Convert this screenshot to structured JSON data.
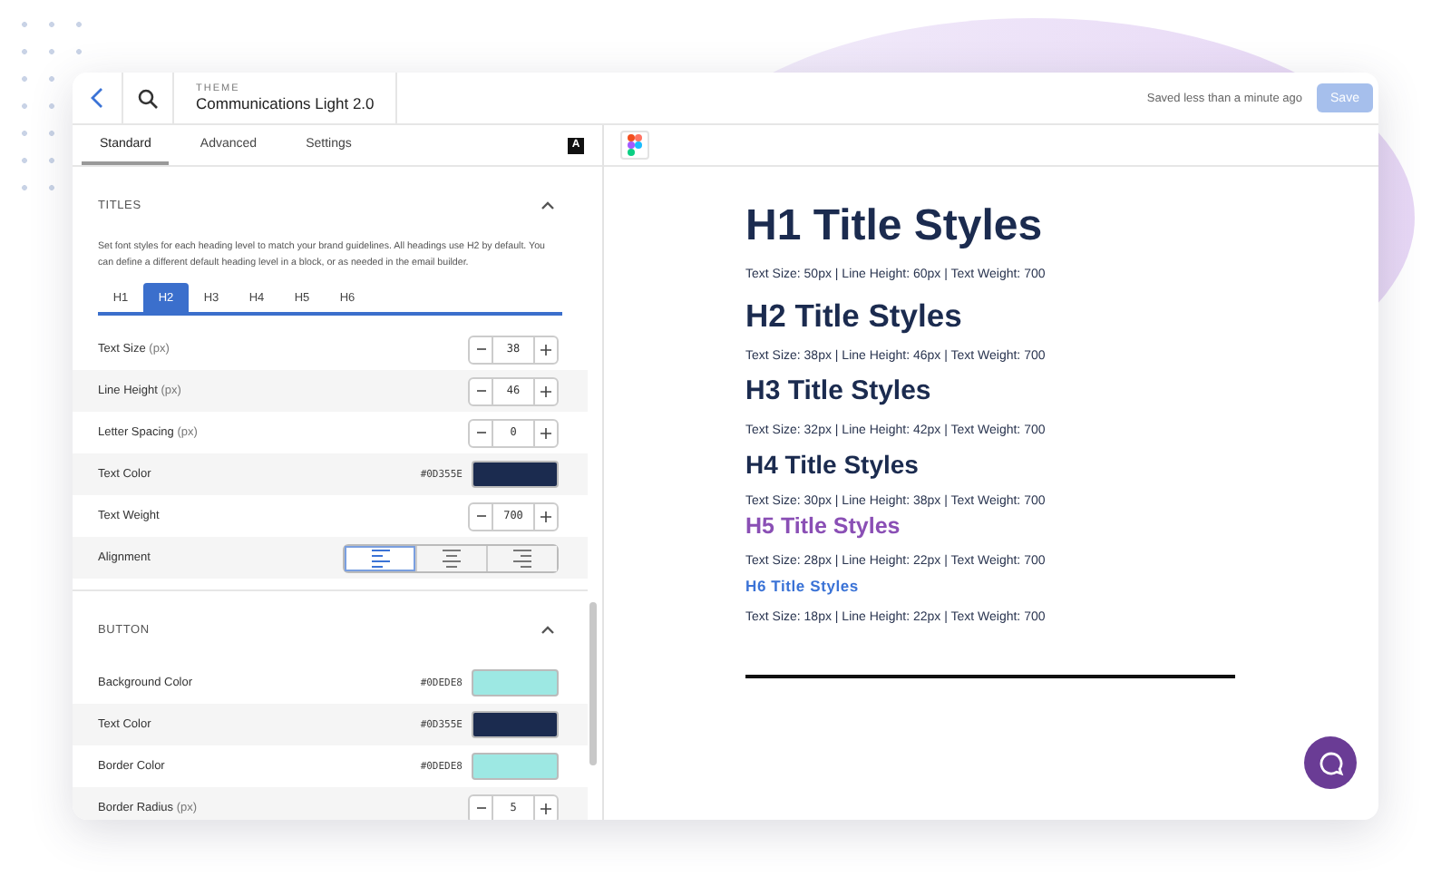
{
  "header": {
    "theme_label": "THEME",
    "theme_name": "Communications Light 2.0",
    "save_status": "Saved less than a minute ago",
    "save_button": "Save"
  },
  "panel_tabs": [
    {
      "label": "Standard",
      "selected": true
    },
    {
      "label": "Advanced",
      "selected": false
    },
    {
      "label": "Settings",
      "selected": false
    }
  ],
  "panel_badge": "A",
  "sections": [
    {
      "title": "TITLES",
      "expanded": true,
      "description": "Set font styles for each heading level to match your brand guidelines. All headings use H2 by default. You can define a different default heading level in a block, or as needed in the email builder.",
      "levels": [
        {
          "label": "H1",
          "selected": false
        },
        {
          "label": "H2",
          "selected": true
        },
        {
          "label": "H3",
          "selected": false
        },
        {
          "label": "H4",
          "selected": false
        },
        {
          "label": "H5",
          "selected": false
        },
        {
          "label": "H6",
          "selected": false
        }
      ],
      "rows": [
        {
          "kind": "stepper",
          "label": "Text Size",
          "unit": "(px)",
          "value": "38"
        },
        {
          "kind": "stepper",
          "label": "Line Height",
          "unit": "(px)",
          "value": "46"
        },
        {
          "kind": "stepper",
          "label": "Letter Spacing",
          "unit": "(px)",
          "value": "0"
        },
        {
          "kind": "color",
          "label": "Text Color",
          "value": "#0D355E",
          "color": "#1b2b4f"
        },
        {
          "kind": "stepper",
          "label": "Text Weight",
          "value": "700"
        },
        {
          "kind": "alignment",
          "label": "Alignment",
          "options": [
            {
              "kind": "left",
              "selected": true
            },
            {
              "kind": "center",
              "selected": false
            },
            {
              "kind": "right",
              "selected": false
            }
          ]
        }
      ]
    },
    {
      "title": "BUTTON",
      "expanded": true,
      "rows": [
        {
          "kind": "color",
          "label": "Background Color",
          "value": "#0DEDE8",
          "color": "#9de8e3"
        },
        {
          "kind": "color",
          "label": "Text Color",
          "value": "#0D355E",
          "color": "#1b2b4f"
        },
        {
          "kind": "color",
          "label": "Border Color",
          "value": "#0DEDE8",
          "color": "#9de8e3"
        },
        {
          "kind": "stepper",
          "label": "Border Radius",
          "unit": "(px)",
          "value": "5"
        }
      ]
    }
  ],
  "preview": [
    {
      "title": "H1 Title Styles",
      "color": "#1b2b4f",
      "specs": "Text Size: 50px | Line Height: 60px | Text Weight: 700"
    },
    {
      "title": "H2 Title Styles",
      "color": "#1b2b4f",
      "specs": "Text Size: 38px | Line Height: 46px | Text Weight: 700"
    },
    {
      "title": "H3 Title Styles",
      "color": "#1b2b4f",
      "specs": "Text Size: 32px | Line Height: 42px | Text Weight: 700"
    },
    {
      "title": "H4 Title Styles",
      "color": "#1b2b4f",
      "specs": "Text Size: 30px | Line Height: 38px | Text Weight: 700"
    },
    {
      "title": "H5 Title Styles",
      "color": "#8a4fb5",
      "specs": "Text Size: 28px | Line Height: 22px | Text Weight: 700"
    },
    {
      "title": "H6 Title Styles",
      "color": "#3b73d6",
      "specs": "Text Size: 18px | Line Height: 22px | Text Weight: 700"
    }
  ]
}
